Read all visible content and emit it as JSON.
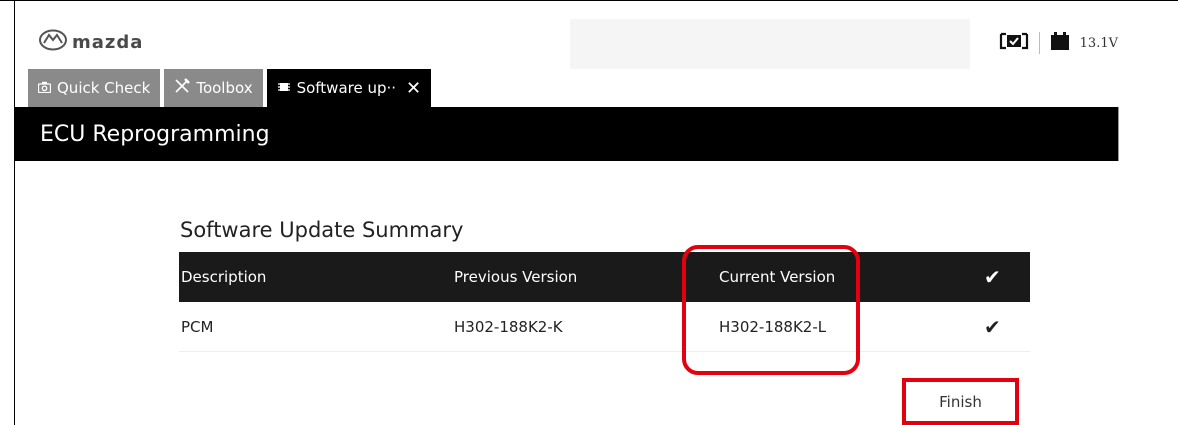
{
  "brand": {
    "logo_text": "mazda"
  },
  "status": {
    "voltage": "13.1V"
  },
  "tabs": [
    {
      "label": "Quick Check",
      "icon": "camera-icon"
    },
    {
      "label": "Toolbox",
      "icon": "tools-icon"
    },
    {
      "label": "Software up··",
      "icon": "chip-icon",
      "close": "✕"
    }
  ],
  "header": {
    "title": "ECU Reprogramming"
  },
  "summary": {
    "title": "Software Update Summary",
    "columns": [
      "Description",
      "Previous Version",
      "Current Version",
      "✔"
    ],
    "rows": [
      {
        "description": "PCM",
        "previous": "H302-188K2-K",
        "current": "H302-188K2-L",
        "check": "✔"
      }
    ]
  },
  "actions": {
    "finish_label": "Finish"
  },
  "colors": {
    "highlight": "#e3000f",
    "header_bg": "#000000",
    "table_head_bg": "#1a1a1a",
    "tab_bg": "#8a8a8a"
  }
}
